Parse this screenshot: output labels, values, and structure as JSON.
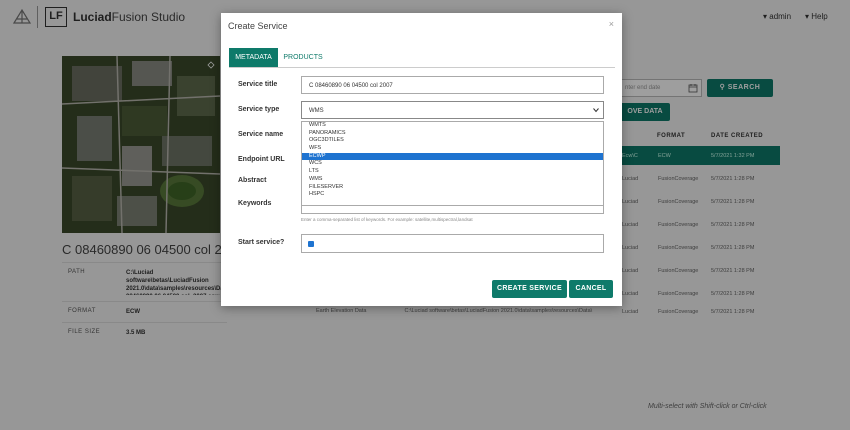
{
  "app": {
    "title_bold": "Luciad",
    "title_rest": "Fusion Studio",
    "logo_text": "LF",
    "user_menu": "▾ admin",
    "help_menu": "▾ Help"
  },
  "detail": {
    "title": "C 08460890 06 04500 col 2007",
    "props": [
      {
        "key": "PATH",
        "value": "C:\\Luciad software\\betas\\LuciadFusion 2021.0\\data\\samples\\resources\\Data\\Ecw\\C 08460890 06 04500 col_2007.ecw"
      },
      {
        "key": "FORMAT",
        "value": "ECW"
      },
      {
        "key": "FILE SIZE",
        "value": "3.5 MB"
      }
    ]
  },
  "search": {
    "date_placeholder": "nter end date",
    "search_label": "SEARCH",
    "remove_label": "OVE DATA"
  },
  "table": {
    "headers": [
      "FORMAT",
      "DATE CREATED"
    ],
    "rows": [
      {
        "path": "Ecw\\C",
        "format": "ECW",
        "date": "5/7/2021 1:32 PM"
      },
      {
        "path": "Luciad",
        "format": "FusionCoverage",
        "date": "5/7/2021 1:28 PM"
      },
      {
        "path": "Luciad",
        "format": "FusionCoverage",
        "date": "5/7/2021 1:28 PM"
      },
      {
        "path": "Luciad",
        "format": "FusionCoverage",
        "date": "5/7/2021 1:28 PM"
      },
      {
        "path": "Luciad",
        "format": "FusionCoverage",
        "date": "5/7/2021 1:28 PM"
      },
      {
        "path": "Luciad",
        "format": "FusionCoverage",
        "date": "5/7/2021 1:28 PM"
      },
      {
        "path": "Luciad",
        "format": "FusionCoverage",
        "date": "5/7/2021 1:28 PM"
      },
      {
        "path": "Luciad",
        "format": "FusionCoverage",
        "date": "5/7/2021 1:28 PM"
      }
    ],
    "earth_row_name": "Earth Elevation Data",
    "earth_row_path": "C:\\Luciad software\\betas\\LuciadFusion 2021.0\\data\\samples\\resources\\Data\\",
    "multi_hint": "Multi-select with Shift-click or Ctrl-click"
  },
  "modal": {
    "title": "Create Service",
    "close": "×",
    "tabs": [
      "METADATA",
      "PRODUCTS"
    ],
    "labels": {
      "service_title": "Service title",
      "service_type": "Service type",
      "service_name": "Service name",
      "endpoint_url": "Endpoint URL",
      "abstract": "Abstract",
      "keywords": "Keywords",
      "start_service": "Start service?"
    },
    "service_title_value": "C 08460890 06 04500 col 2007",
    "service_type_value": "WMS",
    "keywords_hint": "Enter a comma-separated list of keywords. For example: satellite,multispectral,landsat",
    "type_options": [
      "WMTS",
      "PANORAMICS",
      "OGC3DTILES",
      "WFS",
      "ECWP",
      "WCS",
      "LTS",
      "WMS",
      "FILESERVER",
      "HSPC"
    ],
    "highlighted_option": "ECWP",
    "start_service_checked": true,
    "create_button": "CREATE SERVICE",
    "cancel_button": "CANCEL"
  },
  "colors": {
    "accent": "#0e7a6a",
    "highlight": "#1e73d0"
  }
}
